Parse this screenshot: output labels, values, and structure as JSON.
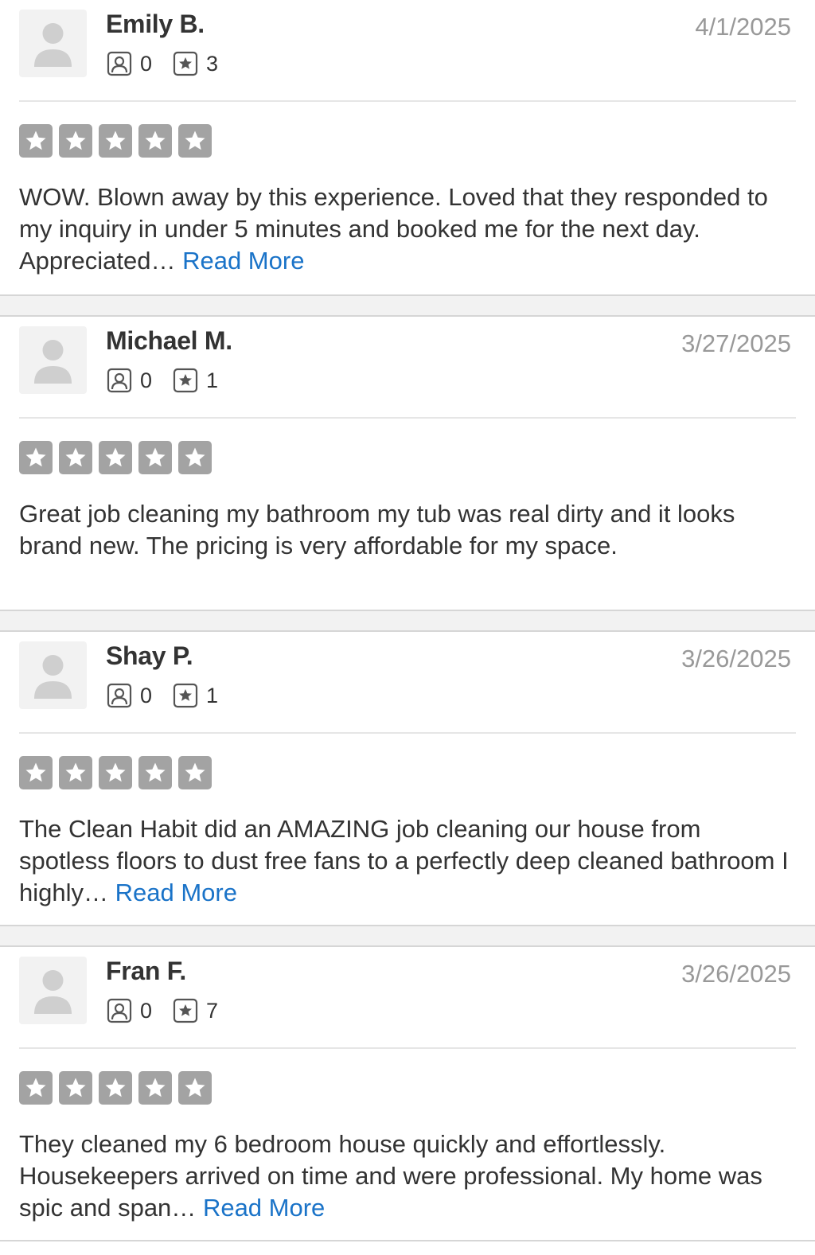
{
  "reviews": [
    {
      "name": "Emily B.",
      "date": "4/1/2025",
      "friends": "0",
      "review_count": "3",
      "rating": 5,
      "text": "WOW. Blown away by this experience. Loved that they responded to my inquiry in under 5 minutes and booked me for the next day. Appreciated…",
      "read_more": "Read More"
    },
    {
      "name": "Michael M.",
      "date": "3/27/2025",
      "friends": "0",
      "review_count": "1",
      "rating": 5,
      "text": "Great job cleaning my bathroom my tub was real dirty and it looks brand new. The pricing is very affordable for my space.",
      "read_more": ""
    },
    {
      "name": "Shay P.",
      "date": "3/26/2025",
      "friends": "0",
      "review_count": "1",
      "rating": 5,
      "text": "The Clean Habit did an AMAZING job cleaning our house from spotless floors to dust free fans to a perfectly deep cleaned bathroom I highly…",
      "read_more": "Read More"
    },
    {
      "name": "Fran F.",
      "date": "3/26/2025",
      "friends": "0",
      "review_count": "7",
      "rating": 5,
      "text": "They cleaned my 6 bedroom house quickly and effortlessly.  Housekeepers arrived on time and were professional.  My home was spic and span…",
      "read_more": "Read More"
    }
  ],
  "colors": {
    "star_fill": "#a3a3a3",
    "link": "#1a73c8",
    "date": "#999999",
    "text": "#333333"
  }
}
